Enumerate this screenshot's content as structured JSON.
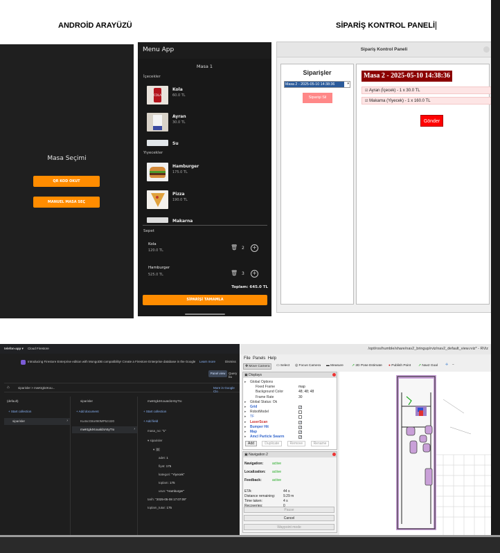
{
  "headers": {
    "left": "ANDROİD ARAYÜZÜ",
    "right": "SİPARİŞ KONTROL PANELİ"
  },
  "screen1": {
    "title": "Masa Seçimi",
    "qr_button": "QR KOD OKUT",
    "manual_button": "MANUEL MASA SEÇ"
  },
  "screen2": {
    "appbar": "Menu App",
    "table": "Masa 1",
    "drinks_label": "İçecekler",
    "foods_label": "Yiyecekler",
    "drinks": [
      {
        "name": "Kola",
        "price": "60.0 TL"
      },
      {
        "name": "Ayran",
        "price": "30.0 TL"
      },
      {
        "name": "Su",
        "price": ""
      }
    ],
    "foods": [
      {
        "name": "Hamburger",
        "price": "175.0 TL"
      },
      {
        "name": "Pizza",
        "price": "190.0 TL"
      },
      {
        "name": "Makarna",
        "price": ""
      }
    ],
    "cart_label": "Sepet",
    "cart": [
      {
        "name": "Kola",
        "price": "120.0 TL",
        "qty": "2"
      },
      {
        "name": "Hamburger",
        "price": "525.0 TL",
        "qty": "3"
      }
    ],
    "total": "Toplam: 645.0 TL",
    "complete_button": "SİPARİŞİ TAMAMLA",
    "kola_logo": "COLA"
  },
  "panel": {
    "window_title": "Sipariş Kontrol Paneli",
    "orders_label": "Siparişler",
    "selected_order": "Masa 2 - 2025-05-10 14:38:36",
    "delete_button": "Siparişi Sil",
    "detail_title": "Masa 2 - 2025-05-10 14:38:36",
    "items": [
      "Ayran (İçecek) - 1 x 30.0 TL",
      "Makarna (Yiyecek) - 1 x 160.0 TL"
    ],
    "send_button": "Gönder"
  },
  "firestore": {
    "app": "telefon-app ▾",
    "product": "Cloud Firestore",
    "banner": "Introducing Firestore Enterprise edition with MongoDB compatibility! Create a Firestore Enterprise database in the Google Cloud Console.",
    "learn_more": "Learn more",
    "dismiss": "Dismiss",
    "panel_view": "Panel view",
    "query_builder": "Query bu",
    "path": "siparisler  >  mwKtgk4Kou...",
    "more_in_console": "More in Google Clo",
    "col1": {
      "header": "(default)",
      "start": "+ Start collection",
      "item": "siparisler"
    },
    "col2": {
      "header": "siparisler",
      "add": "+ Add document",
      "docs": [
        "Ku4scG8or9I0MP5z1t20",
        "mwKtgk4Kouald4A5yTIo"
      ]
    },
    "col3": {
      "header": "mwKtgk4KouaId4A5yTIo",
      "start": "+ Start collection",
      "add_field": "+ Add field",
      "fields": [
        {
          "k": "masa_no:",
          "v": "\"1\""
        },
        {
          "k": "siparisler",
          "v": ""
        },
        {
          "k": "0",
          "v": ""
        },
        {
          "k": "adet:",
          "v": "1"
        },
        {
          "k": "fiyat:",
          "v": "175"
        },
        {
          "k": "kategori:",
          "v": "\"Yiyecek\""
        },
        {
          "k": "toplam:",
          "v": "175"
        },
        {
          "k": "urun:",
          "v": "\"Hamburger\""
        },
        {
          "k": "tarih:",
          "v": "\"2025-05-08 17:07:09\""
        },
        {
          "k": "toplam_tutar:",
          "v": "175"
        }
      ]
    }
  },
  "rviz": {
    "title": "/opt/ros/humble/share/nav2_bringup/rviz/nav2_default_view.rviz* - RViz",
    "menu": [
      "File",
      "Panels",
      "Help"
    ],
    "tools": [
      "Move Camera",
      "Select",
      "Focus Camera",
      "Measure",
      "2D Pose Estimate",
      "Publish Point",
      "Nav2 Goal"
    ],
    "displays_title": "Displays",
    "displays": [
      {
        "label": "Global Options",
        "value": ""
      },
      {
        "label": "Fixed Frame",
        "value": "map"
      },
      {
        "label": "Background Color",
        "value": "48; 48; 48"
      },
      {
        "label": "Frame Rate",
        "value": "30"
      },
      {
        "label": "Global Status: Ok",
        "value": ""
      },
      {
        "label": "Grid",
        "value": "✓"
      },
      {
        "label": "RobotModel",
        "value": ""
      },
      {
        "label": "TF",
        "value": ""
      },
      {
        "label": "LaserScan",
        "value": "✓"
      },
      {
        "label": "Bumper Hit",
        "value": "✓"
      },
      {
        "label": "Map",
        "value": "✓"
      },
      {
        "label": "Amcl Particle Swarm",
        "value": "✓"
      }
    ],
    "display_buttons": [
      "Add",
      "Duplicate",
      "Remove",
      "Rename"
    ],
    "nav_title": "Navigation 2",
    "status": [
      {
        "k": "Navigation:",
        "v": "active"
      },
      {
        "k": "Localization:",
        "v": "active"
      },
      {
        "k": "Feedback:",
        "v": "active"
      }
    ],
    "metrics": [
      {
        "k": "ETA:",
        "v": "44 s"
      },
      {
        "k": "Distance remaining:",
        "v": "9.29 m"
      },
      {
        "k": "Time taken:",
        "v": "4 s"
      },
      {
        "k": "Recoveries:",
        "v": "0"
      }
    ],
    "buttons": [
      "Pause",
      "Cancel",
      "Waypoint mode"
    ]
  },
  "colors": {
    "orange": "#ff8c00",
    "dark_red": "#8b0000",
    "red": "#ff0000",
    "pink": "#ff8888",
    "blue_sel": "#2a5a9a"
  }
}
